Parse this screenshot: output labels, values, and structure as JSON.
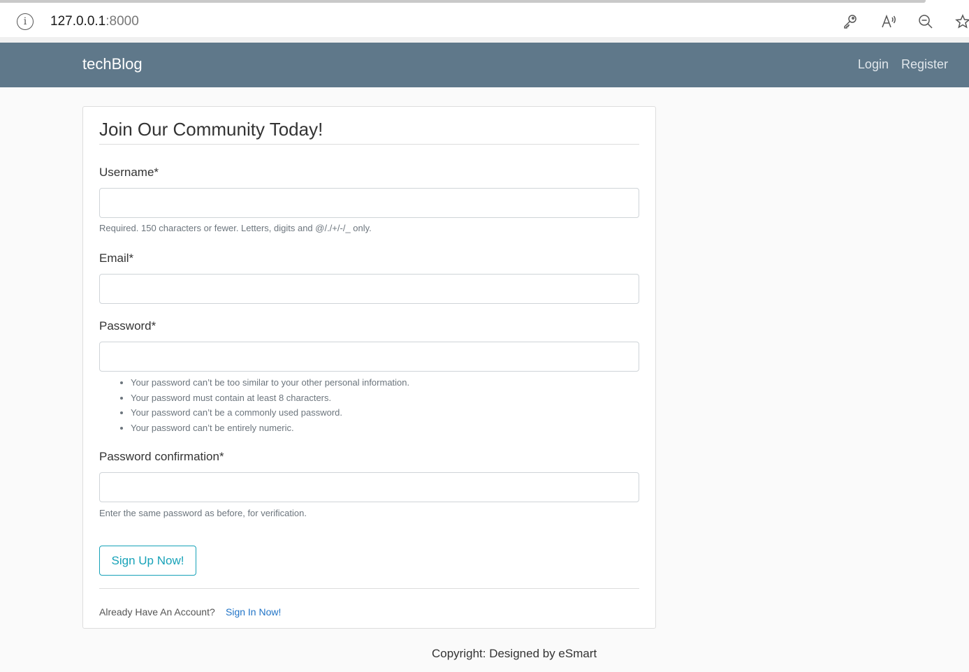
{
  "browser": {
    "url_host": "127.0.0.1",
    "url_port": ":8000"
  },
  "navbar": {
    "brand": "techBlog",
    "links": [
      "Login",
      "Register"
    ]
  },
  "form": {
    "title": "Join Our Community Today!",
    "fields": [
      {
        "label": "Username*",
        "value": "",
        "help": "Required. 150 characters or fewer. Letters, digits and @/./+/-/_ only."
      },
      {
        "label": "Email*",
        "value": ""
      },
      {
        "label": "Password*",
        "value": "",
        "help_list": [
          "Your password can’t be too similar to your other personal information.",
          "Your password must contain at least 8 characters.",
          "Your password can’t be a commonly used password.",
          "Your password can’t be entirely numeric."
        ]
      },
      {
        "label": "Password confirmation*",
        "value": "",
        "help": "Enter the same password as before, for verification."
      }
    ],
    "submit_label": "Sign Up Now!",
    "account_prompt": "Already Have An Account?",
    "signin_label": "Sign In Now!"
  },
  "footer": {
    "copyright": "Copyright: Designed by eSmart"
  },
  "colors": {
    "navbar": "#5f788a",
    "button_accent": "#17a2b8",
    "link": "#1f73c7"
  }
}
